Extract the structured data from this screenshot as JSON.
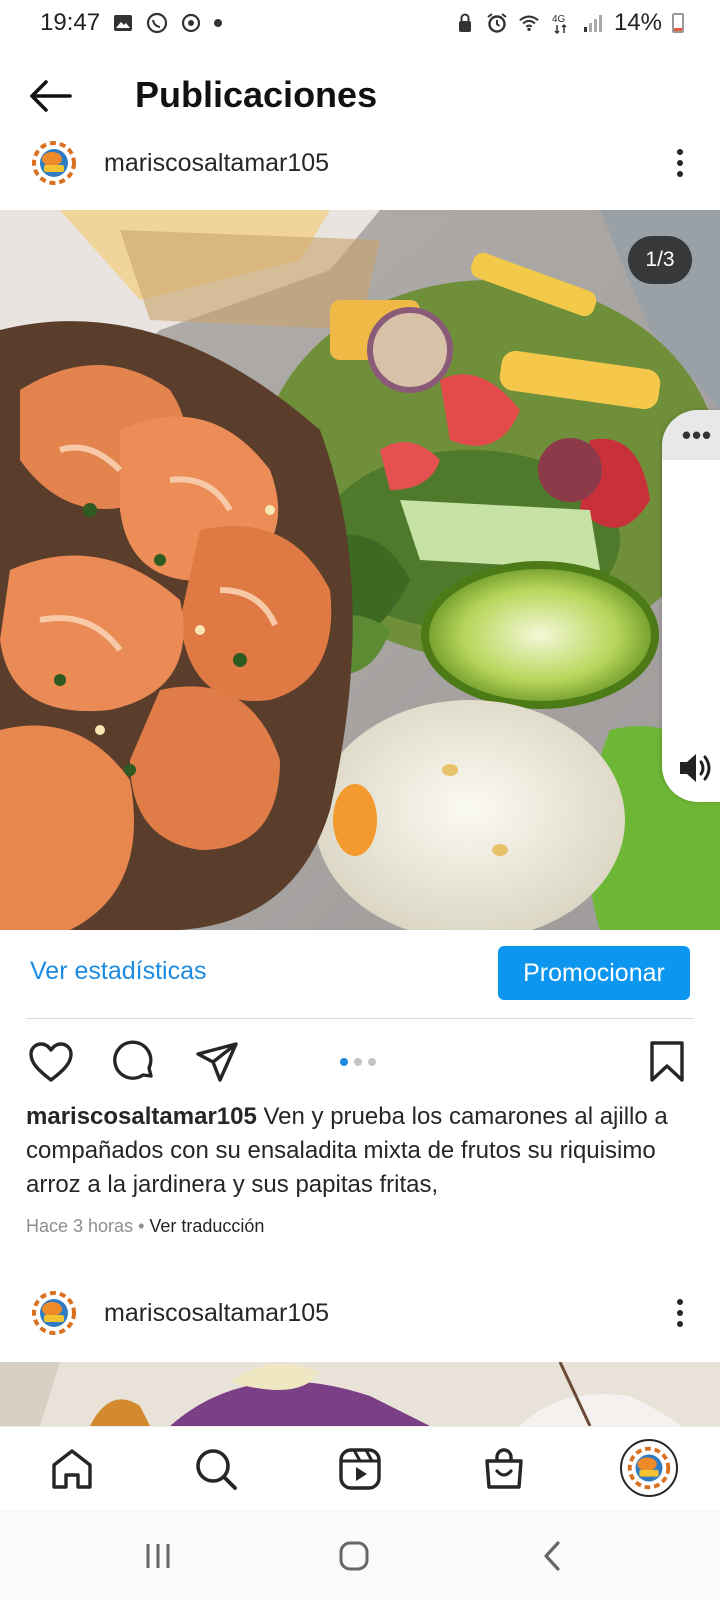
{
  "status_bar": {
    "time": "19:47",
    "battery": "14%",
    "icons": [
      "gallery-icon",
      "whatsapp-icon",
      "sync-icon",
      "lock-icon",
      "alarm-icon",
      "wifi-icon",
      "4g-icon",
      "signal-icon",
      "battery-icon"
    ]
  },
  "header": {
    "title": "Publicaciones",
    "back_icon": "arrow-left-icon"
  },
  "post": {
    "username": "mariscosaltamar105",
    "counter": "1/3",
    "insights_label": "Ver estadísticas",
    "promote_label": "Promocionar",
    "caption_user": "mariscosaltamar105",
    "caption_text": " Ven y prueba los camarones al ajillo a compañados con su ensaladita mixta de frutos su riquisimo arroz a la jardinera y sus papitas fritas,",
    "time_ago": "Hace 3 horas",
    "separator": " • ",
    "translate_label": "Ver traducción",
    "carousel": {
      "count": 3,
      "active": 1
    }
  },
  "next_post": {
    "username": "mariscosaltamar105"
  },
  "side_panel": {
    "more_label": "•••"
  },
  "bottom_nav": {
    "items": [
      "home-icon",
      "search-icon",
      "reels-icon",
      "shop-icon",
      "profile-avatar"
    ]
  },
  "colors": {
    "accent_blue": "#0c96f0",
    "link_blue": "#1c8be0",
    "text": "#262626",
    "muted": "#8e8e8e"
  }
}
